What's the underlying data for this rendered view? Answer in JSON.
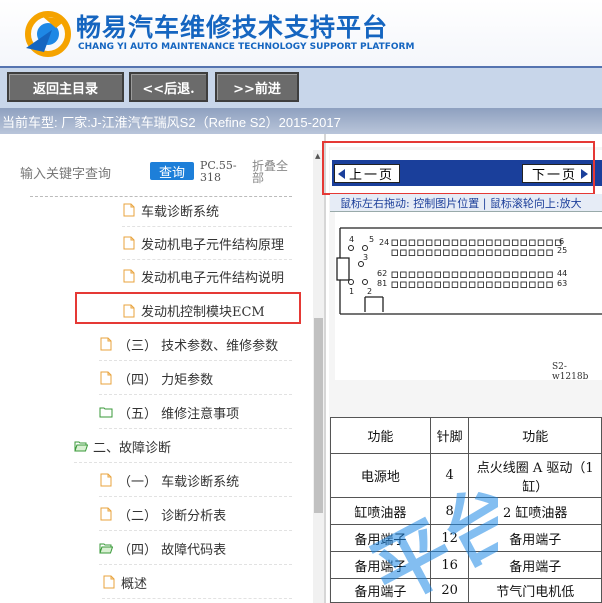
{
  "header": {
    "title": "畅易汽车维修技术支持平台",
    "subtitle": "CHANG YI AUTO MAINTENANCE TECHNOLOGY SUPPORT PLATFORM",
    "brand_color": "#1565c0"
  },
  "toolbar": {
    "home_label": "返回主目录",
    "back_label": "<<后退.",
    "forward_label": ">>前进"
  },
  "vehicle": {
    "text": "当前车型:  厂家:J-江淮汽车瑞风S2（Refine S2）2015-2017"
  },
  "sidebar": {
    "search_placeholder": "输入关键字查询",
    "search_button": "查询",
    "code": "PC.55-318",
    "collapse_all": "折叠全部",
    "items": [
      {
        "label": "车载诊断系统",
        "icon": "file-icon"
      },
      {
        "label": "发动机电子元件结构原理",
        "icon": "file-icon"
      },
      {
        "label": "发动机电子元件结构说明",
        "icon": "file-icon"
      },
      {
        "label": "发动机控制模块ECM",
        "icon": "file-icon",
        "selected": true
      },
      {
        "label": "（三） 技术参数、维修参数",
        "icon": "file-icon"
      },
      {
        "label": "（四） 力矩参数",
        "icon": "file-icon"
      },
      {
        "label": "（五） 维修注意事项",
        "icon": "folder-icon"
      },
      {
        "label": "二、故障诊断",
        "icon": "folder-open-icon"
      },
      {
        "label": "（一） 车载诊断系统",
        "icon": "file-icon"
      },
      {
        "label": "（二） 诊断分析表",
        "icon": "file-icon"
      },
      {
        "label": "（四） 故障代码表",
        "icon": "folder-open-icon"
      },
      {
        "label": "概述",
        "icon": "file-icon"
      }
    ]
  },
  "viewer": {
    "prev_label": "上一页",
    "next_label": "下一页",
    "hint": "鼠标左右拖动: 控制图片位置 | 鼠标滚轮向上:放大",
    "connector_labels": {
      "l4": "4",
      "l5": "5",
      "l24": "24",
      "l6": "6",
      "l25": "25",
      "l3": "3",
      "l62": "62",
      "l44": "44",
      "l81": "81",
      "l63": "63",
      "l1": "1",
      "l2": "2"
    },
    "figure_label": "S2-w1218b",
    "table_headers": [
      "功能",
      "针脚",
      "功能"
    ],
    "table_rows": [
      [
        "电源地",
        "4",
        "点火线圈 A 驱动（1缸）"
      ],
      [
        "缸喷油器",
        "8",
        "2 缸喷油器"
      ],
      [
        "备用端子",
        "12",
        "备用端子"
      ],
      [
        "备用端子",
        "16",
        "备用端子"
      ],
      [
        "备用端子",
        "20",
        "节气门电机低"
      ]
    ],
    "watermark": "平台"
  }
}
